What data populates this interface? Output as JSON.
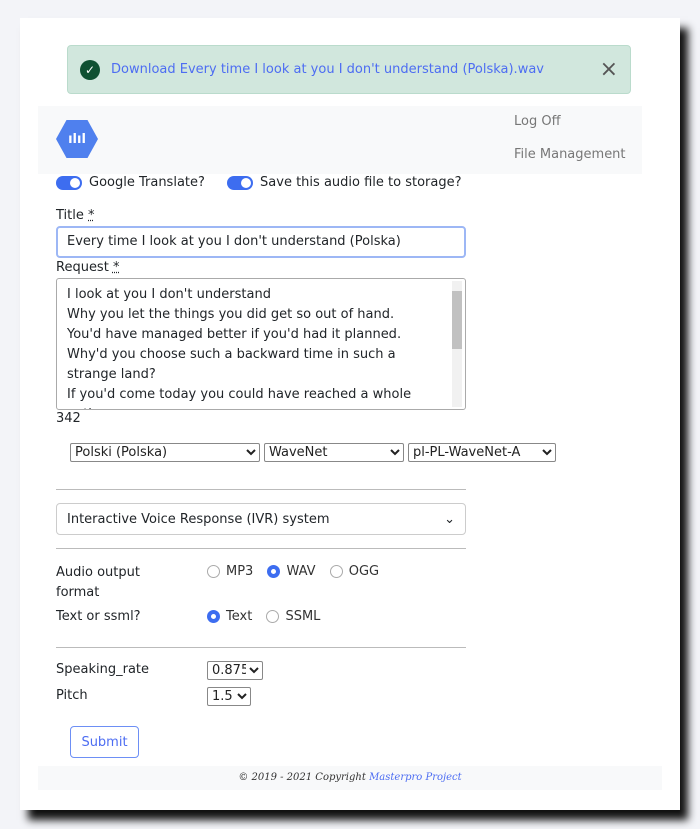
{
  "alert": {
    "icon": "check-circle-icon",
    "text": "Download Every time I look at you I don't understand (Polska).wav",
    "close": "×"
  },
  "nav": {
    "logo": "audio-waveform-logo",
    "logo_glyph": "ılıl",
    "log_off": "Log Off",
    "file_management": "File Management"
  },
  "toggles": {
    "translate": "Google Translate?",
    "save": "Save this audio file to storage?"
  },
  "title": {
    "label": "Title",
    "req": "*",
    "value": "Every time I look at you I don't understand (Polska)"
  },
  "request": {
    "label": "Request",
    "req": "*",
    "value": "I look at you I don't understand\nWhy you let the things you did get so out of hand.\nYou'd have managed better if you'd had it planned.\nWhy'd you choose such a backward time in such a strange land?\nIf you'd come today you could have reached a whole nation.",
    "count": "342"
  },
  "selects": {
    "language": "Polski (Polska)",
    "type": "WaveNet",
    "voice": "pl-PL-WaveNet-A"
  },
  "ivr": "Interactive Voice Response (IVR) system",
  "format": {
    "label": "Audio output format",
    "options": [
      "MP3",
      "WAV",
      "OGG"
    ],
    "selected": "WAV"
  },
  "ssml": {
    "label": "Text or ssml?",
    "options": [
      "Text",
      "SSML"
    ],
    "selected": "Text"
  },
  "speaking_rate": {
    "label": "Speaking_rate",
    "value": "0.875"
  },
  "pitch": {
    "label": "Pitch",
    "value": "1.5"
  },
  "submit": "Submit",
  "footer": {
    "text": "© 2019 - 2021 Copyright",
    "link": "Masterpro Project"
  }
}
